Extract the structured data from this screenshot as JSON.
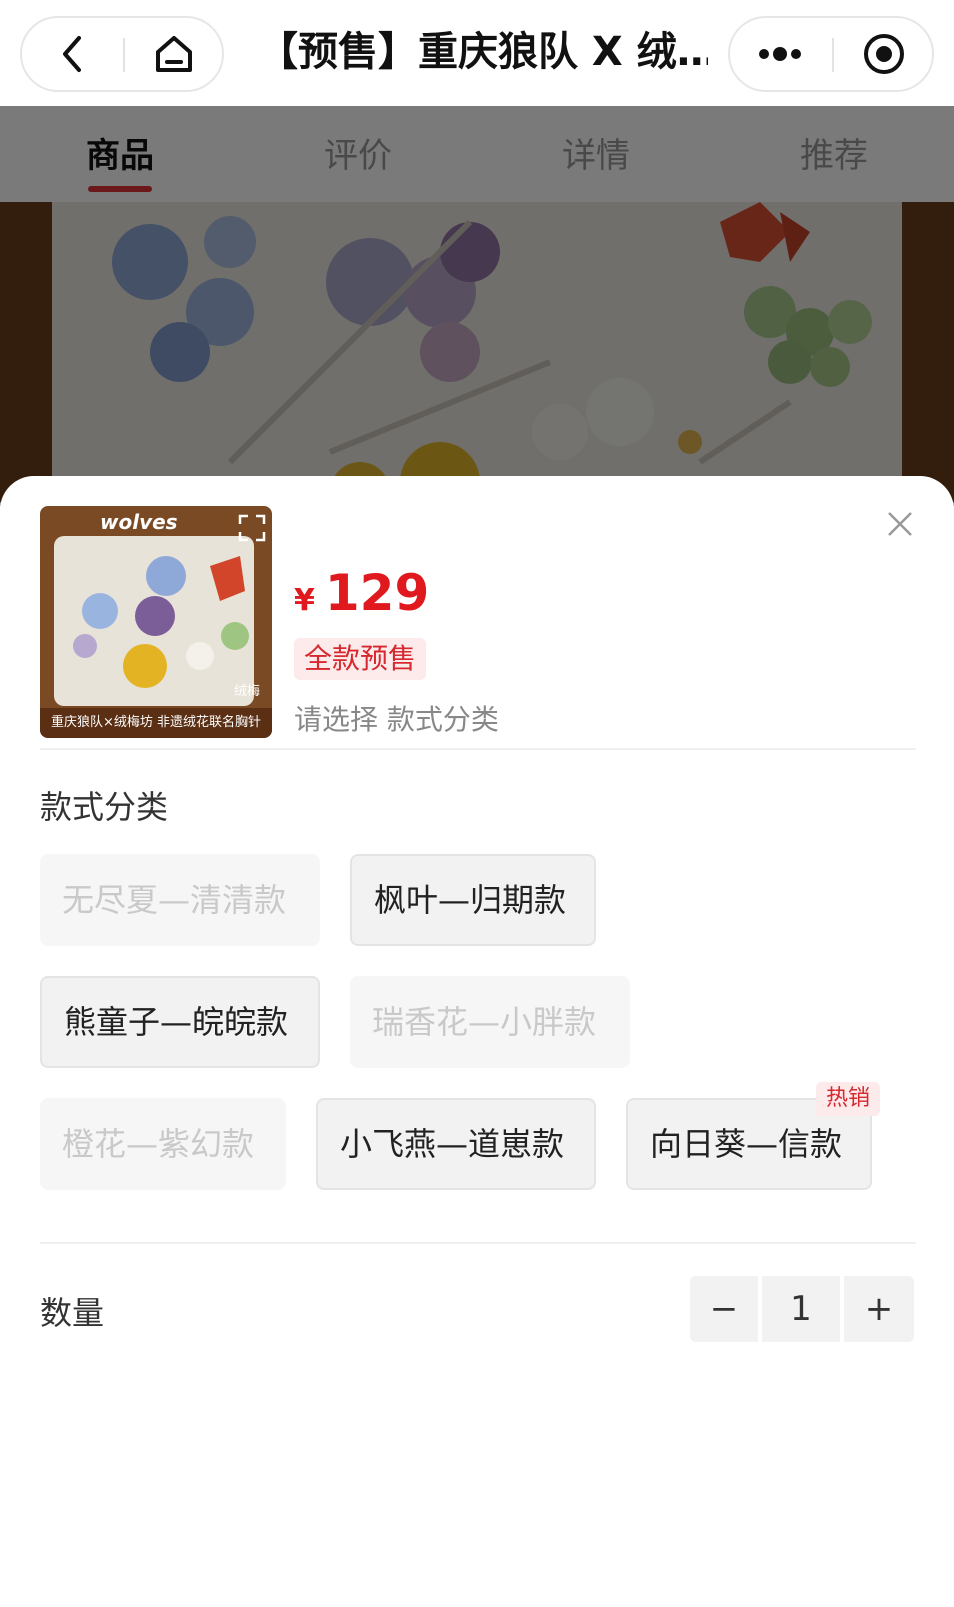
{
  "navbar": {
    "title": "【预售】重庆狼队 X 绒…",
    "back_icon": "chevron-left-icon",
    "home_icon": "home-icon",
    "more_icon": "more-dots-icon",
    "close_miniapp_icon": "target-circle-icon"
  },
  "tabs": [
    {
      "label": "商品",
      "active": true
    },
    {
      "label": "评价",
      "active": false
    },
    {
      "label": "详情",
      "active": false
    },
    {
      "label": "推荐",
      "active": false
    }
  ],
  "product": {
    "thumb_brand": "wolves",
    "thumb_caption": "重庆狼队×绒梅坊  非遗绒花联名胸针",
    "thumb_seal": "绒梅",
    "currency": "¥",
    "price": "129",
    "presale_badge": "全款预售",
    "select_hint": "请选择 款式分类"
  },
  "style_section": {
    "label": "款式分类",
    "options": [
      {
        "label": "无尽夏—清清款",
        "available": false
      },
      {
        "label": "枫叶—归期款",
        "available": true
      },
      {
        "label": "熊童子—皖皖款",
        "available": true
      },
      {
        "label": "瑞香花—小胖款",
        "available": false
      },
      {
        "label": "橙花—紫幻款",
        "available": false
      },
      {
        "label": "小飞燕—道崽款",
        "available": true
      },
      {
        "label": "向日葵—信款",
        "available": true
      }
    ],
    "hot_badge": "热销"
  },
  "quantity": {
    "label": "数量",
    "minus": "−",
    "value": "1",
    "plus": "+"
  },
  "colors": {
    "price_red": "#e0191f",
    "accent_red": "#e0323a",
    "badge_bg": "#fdeaea"
  }
}
